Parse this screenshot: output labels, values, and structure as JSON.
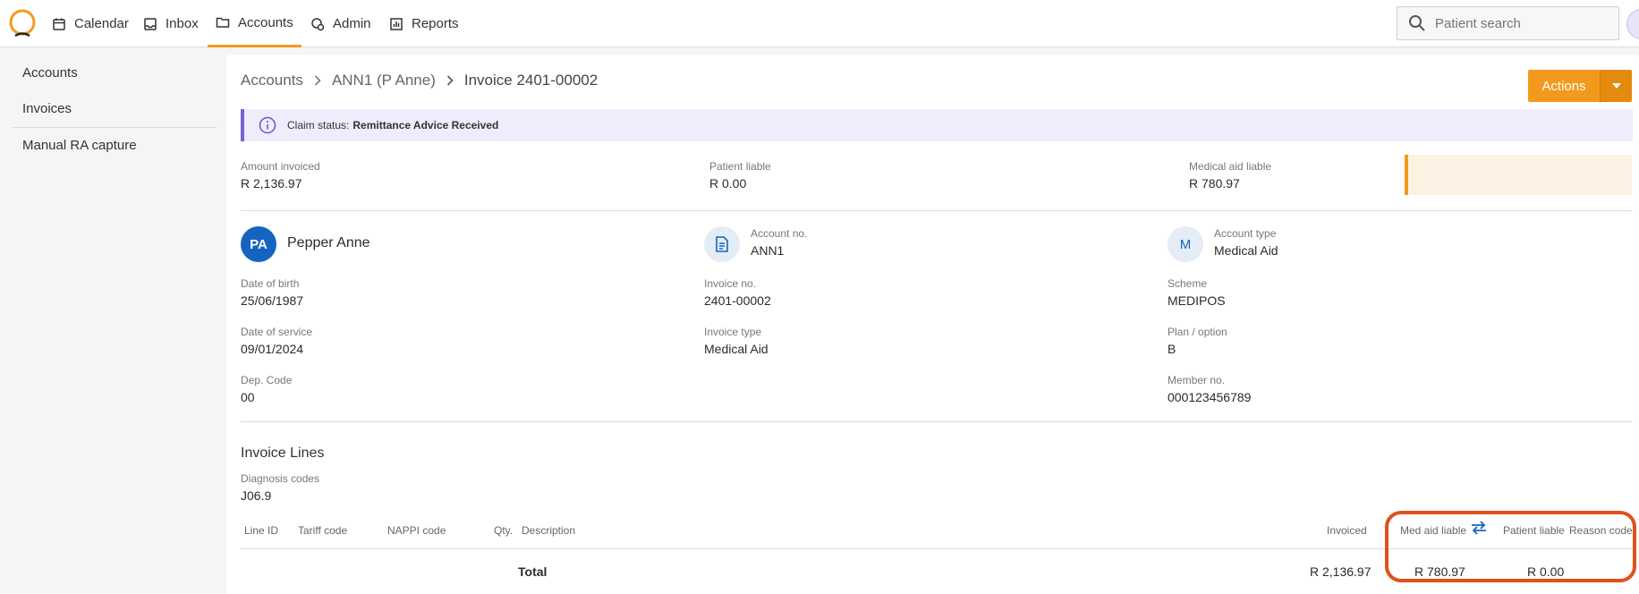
{
  "nav": {
    "items": [
      {
        "label": "Calendar",
        "icon": "calendar-icon"
      },
      {
        "label": "Inbox",
        "icon": "inbox-icon"
      },
      {
        "label": "Accounts",
        "icon": "folder-icon",
        "active": true
      },
      {
        "label": "Admin",
        "icon": "admin-icon"
      },
      {
        "label": "Reports",
        "icon": "reports-icon"
      }
    ],
    "search_placeholder": "Patient search",
    "accent_color": "#f39a1e"
  },
  "sidebar": {
    "items": [
      {
        "label": "Accounts"
      },
      {
        "label": "Invoices"
      },
      {
        "label": "Manual RA capture"
      }
    ]
  },
  "breadcrumb": {
    "items": [
      "Accounts",
      "ANN1 (P Anne)",
      "Invoice 2401-00002"
    ]
  },
  "actions_label": "Actions",
  "claim": {
    "prefix": "Claim status:",
    "status": "Remittance Advice Received"
  },
  "summary": {
    "amount_invoiced_label": "Amount invoiced",
    "amount_invoiced": "R 2,136.97",
    "patient_liable_label": "Patient liable",
    "patient_liable": "R 0.00",
    "medical_aid_liable_label": "Medical aid liable",
    "medical_aid_liable": "R 780.97"
  },
  "patient": {
    "initials": "PA",
    "name": "Pepper Anne",
    "dob_label": "Date of birth",
    "dob": "25/06/1987",
    "dos_label": "Date of service",
    "dos": "09/01/2024",
    "dep_label": "Dep. Code",
    "dep": "00"
  },
  "account": {
    "account_no_label": "Account no.",
    "account_no": "ANN1",
    "invoice_no_label": "Invoice no.",
    "invoice_no": "2401-00002",
    "invoice_type_label": "Invoice type",
    "invoice_type": "Medical Aid"
  },
  "scheme": {
    "initial": "M",
    "account_type_label": "Account type",
    "account_type": "Medical Aid",
    "scheme_label": "Scheme",
    "scheme": "MEDIPOS",
    "plan_label": "Plan / option",
    "plan": "B",
    "member_label": "Member no.",
    "member": "000123456789"
  },
  "invoice_lines": {
    "title": "Invoice Lines",
    "diagnosis_label": "Diagnosis codes",
    "diagnosis": "J06.9",
    "columns": [
      "Line ID",
      "Tariff code",
      "NAPPI code",
      "Qty.",
      "Description",
      "Invoiced",
      "Med aid liable",
      "Patient liable",
      "Reason code"
    ],
    "total_label": "Total",
    "total_invoiced": "R 2,136.97",
    "total_med_aid": "R 780.97",
    "total_patient": "R 0.00"
  }
}
